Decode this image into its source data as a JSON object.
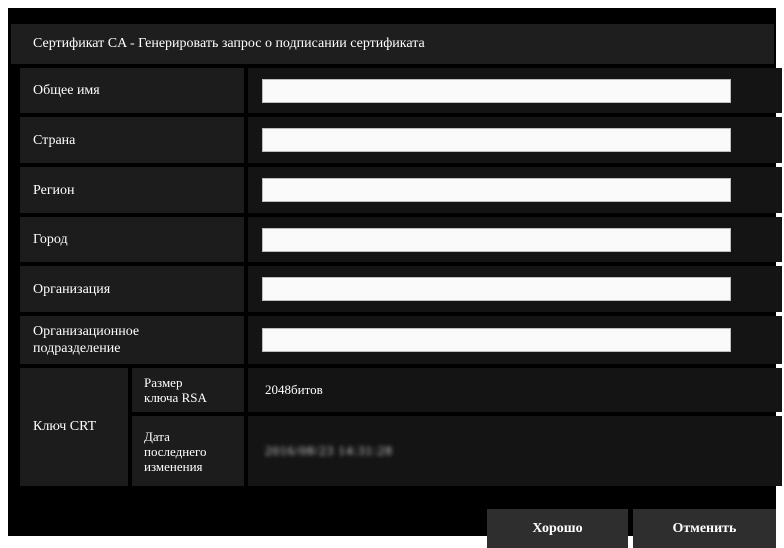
{
  "dialog": {
    "title": "Сертификат CA - Генерировать запрос о подписании сертификата"
  },
  "fields": [
    {
      "label": "Общее имя",
      "value": ""
    },
    {
      "label": "Страна",
      "value": ""
    },
    {
      "label": "Регион",
      "value": ""
    },
    {
      "label": "Город",
      "value": ""
    },
    {
      "label": "Организация",
      "value": ""
    },
    {
      "label": "Организационное подразделение",
      "value": ""
    }
  ],
  "crt_key": {
    "group_label": "Ключ CRT",
    "rsa_label": "Размер ключа RSA",
    "rsa_value": "2048битов",
    "date_label": "Дата последнего изменения",
    "date_value": "2016/08/23 14:31:28"
  },
  "buttons": {
    "ok_label": "Хорошо",
    "cancel_label": "Отменить"
  }
}
